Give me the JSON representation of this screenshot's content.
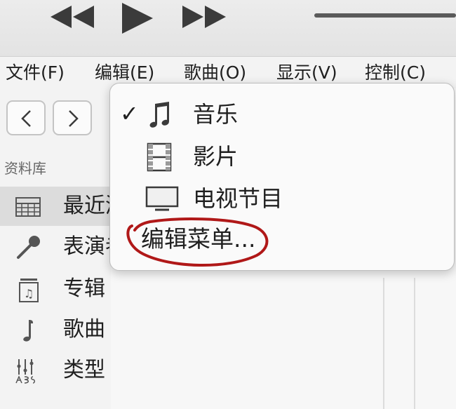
{
  "toolbar": {
    "prev_icon": "rewind-icon",
    "play_icon": "play-icon",
    "next_icon": "fast-forward-icon",
    "volume": "volume-slider"
  },
  "menubar": {
    "items": [
      "文件(F)",
      "编辑(E)",
      "歌曲(O)",
      "显示(V)",
      "控制(C)"
    ]
  },
  "sidebar": {
    "nav": {
      "back_icon": "chevron-left-icon",
      "forward_icon": "chevron-right-icon"
    },
    "library_heading": "资料库",
    "items": [
      {
        "label": "最近添加",
        "icon": "grid-icon",
        "selected": true
      },
      {
        "label": "表演者",
        "icon": "microphone-icon"
      },
      {
        "label": "专辑",
        "icon": "album-icon"
      },
      {
        "label": "歌曲",
        "icon": "music-note-icon"
      },
      {
        "label": "类型",
        "icon": "genre-icon"
      }
    ]
  },
  "dropdown": {
    "items": [
      {
        "label": "音乐",
        "icon": "music-note-icon",
        "checked": true
      },
      {
        "label": "影片",
        "icon": "film-icon",
        "checked": false
      },
      {
        "label": "电视节目",
        "icon": "tv-icon",
        "checked": false
      }
    ],
    "check_mark": "✓",
    "edit_menu": "编辑菜单...",
    "annotation_color": "#b01818"
  },
  "colors": {
    "background": "#f3f3f3",
    "selected_row": "#dcdcdc",
    "text": "#1f1f1f"
  }
}
